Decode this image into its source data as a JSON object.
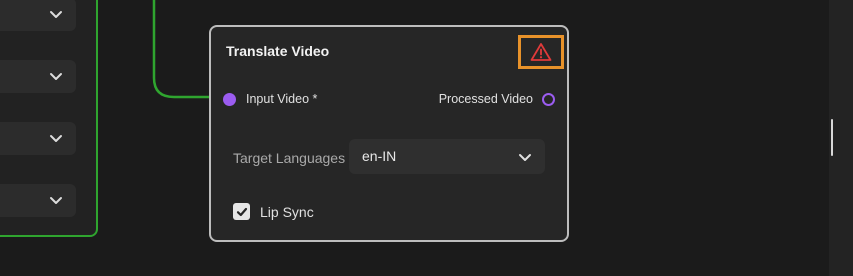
{
  "colors": {
    "background": "#1b1b1b",
    "node_bg": "#262626",
    "node_border": "#bdbdbd",
    "selected_border": "#2fa52f",
    "port": "#9b5cf0",
    "warning": "#e03a3a",
    "warning_highlight": "#e8922a"
  },
  "left_node": {
    "dropdowns": [
      {
        "icon": "chevron-down-icon"
      },
      {
        "icon": "chevron-down-icon"
      },
      {
        "icon": "chevron-down-icon"
      },
      {
        "icon": "chevron-down-icon"
      }
    ]
  },
  "node": {
    "title": "Translate Video",
    "warning_icon": "warning-triangle-icon",
    "input_port": {
      "label": "Input Video *"
    },
    "output_port": {
      "label": "Processed Video"
    },
    "target_languages": {
      "label": "Target Languages",
      "value": "en-IN"
    },
    "lip_sync": {
      "label": "Lip Sync",
      "checked": true
    }
  }
}
